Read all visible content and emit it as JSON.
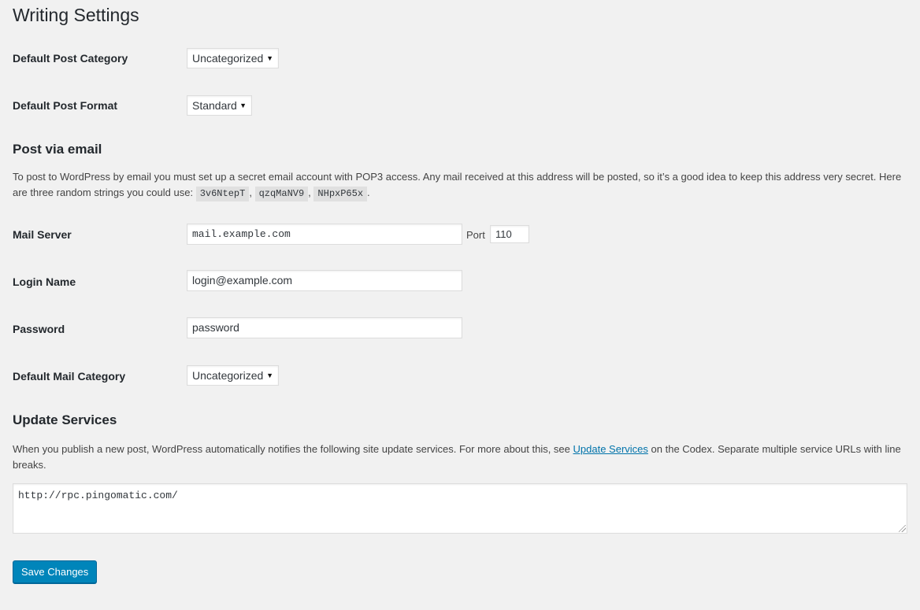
{
  "page": {
    "title": "Writing Settings"
  },
  "default_post_category": {
    "label": "Default Post Category",
    "value": "Uncategorized"
  },
  "default_post_format": {
    "label": "Default Post Format",
    "value": "Standard"
  },
  "post_via_email": {
    "heading": "Post via email",
    "description_prefix": "To post to WordPress by email you must set up a secret email account with POP3 access. Any mail received at this address will be posted, so it’s a good idea to keep this address very secret. Here are three random strings you could use:",
    "random_strings": [
      "3v6NtepT",
      "qzqMaNV9",
      "NHpxP65x"
    ],
    "separator": ",",
    "suffix": "."
  },
  "mail_server": {
    "label": "Mail Server",
    "value": "mail.example.com",
    "port_label": "Port",
    "port_value": "110"
  },
  "login_name": {
    "label": "Login Name",
    "value": "login@example.com"
  },
  "password": {
    "label": "Password",
    "value": "password"
  },
  "default_mail_category": {
    "label": "Default Mail Category",
    "value": "Uncategorized"
  },
  "update_services": {
    "heading": "Update Services",
    "description_prefix": "When you publish a new post, WordPress automatically notifies the following site update services. For more about this, see",
    "link_text": "Update Services",
    "description_suffix": "on the Codex. Separate multiple service URLs with line breaks.",
    "textarea_value": "http://rpc.pingomatic.com/"
  },
  "actions": {
    "save_label": "Save Changes"
  },
  "colors": {
    "background": "#f1f1f1",
    "primary_button": "#0085ba",
    "link": "#0073aa"
  }
}
